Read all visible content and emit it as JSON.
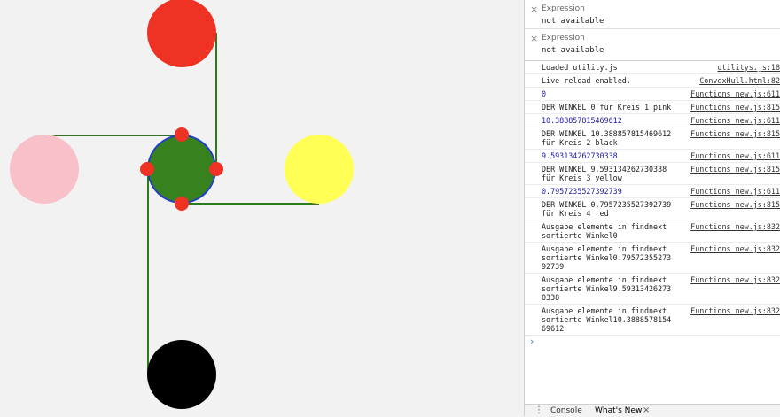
{
  "canvas": {
    "circles": [
      {
        "name": "red",
        "color": "#ee3224"
      },
      {
        "name": "pink",
        "color": "#f8c0c9"
      },
      {
        "name": "green",
        "color": "#37821f"
      },
      {
        "name": "yellow",
        "color": "#ffff55"
      },
      {
        "name": "black",
        "color": "#000000"
      }
    ],
    "line_color": "#2d7a1a",
    "marker_color": "#ee3224",
    "outline_color": "#1f3fc4"
  },
  "watch": [
    {
      "label": "Expression",
      "value": "not available"
    },
    {
      "label": "Expression",
      "value": "not available"
    }
  ],
  "console": [
    {
      "msg": "Loaded utility.js",
      "src": "utilitys.js:18",
      "num": false
    },
    {
      "msg": "Live reload enabled.",
      "src": "ConvexHull.html:82",
      "num": false
    },
    {
      "msg": "0",
      "src": "Functions new.js:611",
      "num": true
    },
    {
      "msg": "DER WINKEL 0 für Kreis 1 pink",
      "src": "Functions new.js:815",
      "num": false
    },
    {
      "msg": "10.388857815469612",
      "src": "Functions new.js:611",
      "num": true
    },
    {
      "msg": "DER WINKEL 10.388857815469612 für Kreis 2 black",
      "src": "Functions new.js:815",
      "num": false
    },
    {
      "msg": "9.593134262730338",
      "src": "Functions new.js:611",
      "num": true
    },
    {
      "msg": "DER WINKEL 9.593134262730338 für Kreis 3 yellow",
      "src": "Functions new.js:815",
      "num": false
    },
    {
      "msg": "0.7957235527392739",
      "src": "Functions new.js:611",
      "num": true
    },
    {
      "msg": "DER WINKEL 0.7957235527392739 für Kreis 4 red",
      "src": "Functions new.js:815",
      "num": false
    },
    {
      "msg": "Ausgabe elemente in findnext sortierte Winkel0",
      "src": "Functions new.js:832",
      "num": false
    },
    {
      "msg": "Ausgabe elemente in findnext sortierte Winkel0.7957235527392739",
      "src": "Functions new.js:832",
      "num": false
    },
    {
      "msg": "Ausgabe elemente in findnext sortierte Winkel9.593134262730338",
      "src": "Functions new.js:832",
      "num": false
    },
    {
      "msg": "Ausgabe elemente in findnext sortierte Winkel10.388857815469612",
      "src": "Functions new.js:832",
      "num": false
    }
  ],
  "prompt_symbol": "›",
  "drawer": {
    "menu_icon": "⋮",
    "tab_console": "Console",
    "tab_whats_new": "What's New",
    "close_glyph": "×"
  },
  "close_glyph": "×"
}
